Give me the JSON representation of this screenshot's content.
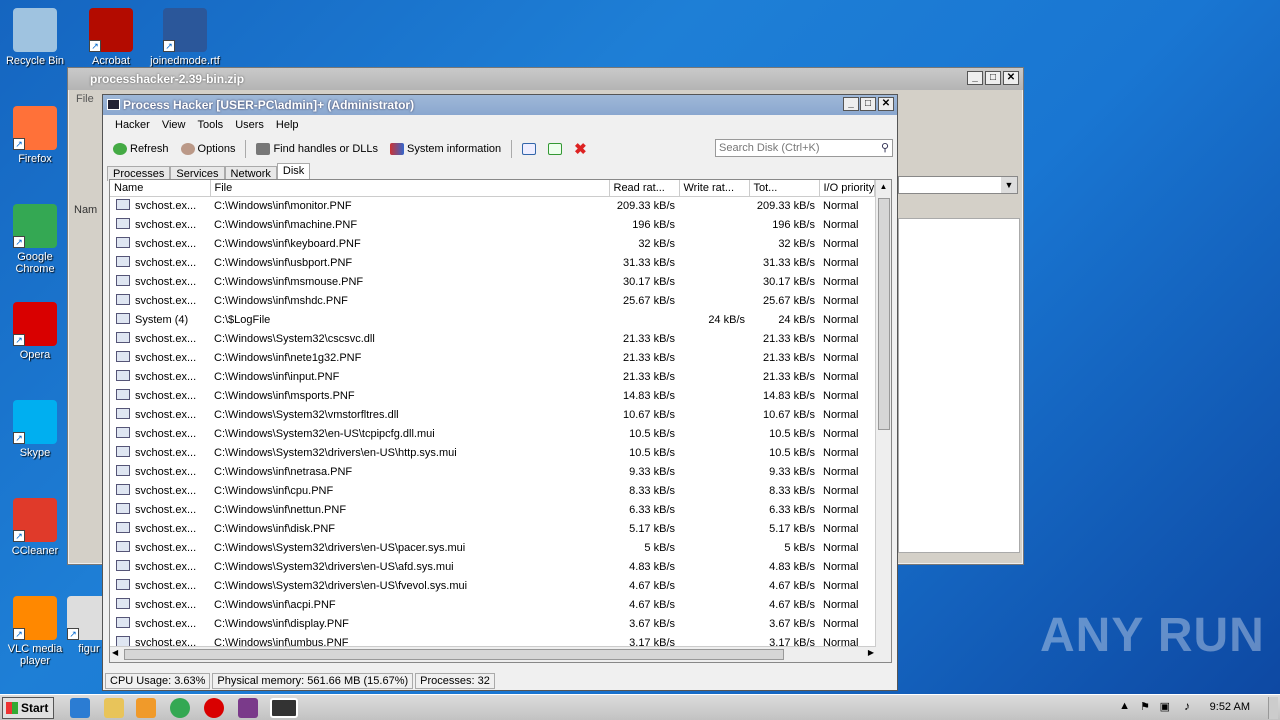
{
  "desktop": {
    "icons": [
      {
        "label": "Recycle Bin",
        "icon": "recycle-bin-icon",
        "color": "#9fc3e0"
      },
      {
        "label": "Acrobat",
        "icon": "acrobat-icon",
        "color": "#b30b00"
      },
      {
        "label": "joinedmode.rtf",
        "icon": "word-document-icon",
        "color": "#2b579a"
      },
      {
        "label": "Firefox",
        "icon": "firefox-icon",
        "color": "#ff7139"
      },
      {
        "label": "Google Chrome",
        "icon": "chrome-icon",
        "color": "#34a853"
      },
      {
        "label": "Opera",
        "icon": "opera-icon",
        "color": "#d90000"
      },
      {
        "label": "Skype",
        "icon": "skype-icon",
        "color": "#00aff0"
      },
      {
        "label": "CCleaner",
        "icon": "ccleaner-icon",
        "color": "#e03a2a"
      },
      {
        "label": "VLC media player",
        "icon": "vlc-icon",
        "color": "#ff8800"
      },
      {
        "label": "figur",
        "icon": "file-icon",
        "color": "#dddddd"
      }
    ]
  },
  "back_window": {
    "title": "processhacker-2.39-bin.zip",
    "menu_file": "File",
    "col_name": "Nam"
  },
  "window": {
    "title": "Process Hacker [USER-PC\\admin]+ (Administrator)",
    "menu": [
      "Hacker",
      "View",
      "Tools",
      "Users",
      "Help"
    ],
    "toolbar": {
      "refresh": "Refresh",
      "options": "Options",
      "find_handles": "Find handles or DLLs",
      "system_info": "System information"
    },
    "search_placeholder": "Search Disk (Ctrl+K)",
    "tabs": [
      "Processes",
      "Services",
      "Network",
      "Disk"
    ],
    "active_tab": "Disk",
    "columns": [
      "Name",
      "File",
      "Read rat...",
      "Write rat...",
      "Tot...",
      "I/O priority"
    ],
    "rows": [
      [
        "svchost.ex...",
        "C:\\Windows\\inf\\monitor.PNF",
        "209.33 kB/s",
        "",
        "209.33 kB/s",
        "Normal"
      ],
      [
        "svchost.ex...",
        "C:\\Windows\\inf\\machine.PNF",
        "196 kB/s",
        "",
        "196 kB/s",
        "Normal"
      ],
      [
        "svchost.ex...",
        "C:\\Windows\\inf\\keyboard.PNF",
        "32 kB/s",
        "",
        "32 kB/s",
        "Normal"
      ],
      [
        "svchost.ex...",
        "C:\\Windows\\inf\\usbport.PNF",
        "31.33 kB/s",
        "",
        "31.33 kB/s",
        "Normal"
      ],
      [
        "svchost.ex...",
        "C:\\Windows\\inf\\msmouse.PNF",
        "30.17 kB/s",
        "",
        "30.17 kB/s",
        "Normal"
      ],
      [
        "svchost.ex...",
        "C:\\Windows\\inf\\mshdc.PNF",
        "25.67 kB/s",
        "",
        "25.67 kB/s",
        "Normal"
      ],
      [
        "System (4)",
        "C:\\$LogFile",
        "",
        "24 kB/s",
        "24 kB/s",
        "Normal"
      ],
      [
        "svchost.ex...",
        "C:\\Windows\\System32\\cscsvc.dll",
        "21.33 kB/s",
        "",
        "21.33 kB/s",
        "Normal"
      ],
      [
        "svchost.ex...",
        "C:\\Windows\\inf\\nete1g32.PNF",
        "21.33 kB/s",
        "",
        "21.33 kB/s",
        "Normal"
      ],
      [
        "svchost.ex...",
        "C:\\Windows\\inf\\input.PNF",
        "21.33 kB/s",
        "",
        "21.33 kB/s",
        "Normal"
      ],
      [
        "svchost.ex...",
        "C:\\Windows\\inf\\msports.PNF",
        "14.83 kB/s",
        "",
        "14.83 kB/s",
        "Normal"
      ],
      [
        "svchost.ex...",
        "C:\\Windows\\System32\\vmstorfltres.dll",
        "10.67 kB/s",
        "",
        "10.67 kB/s",
        "Normal"
      ],
      [
        "svchost.ex...",
        "C:\\Windows\\System32\\en-US\\tcpipcfg.dll.mui",
        "10.5 kB/s",
        "",
        "10.5 kB/s",
        "Normal"
      ],
      [
        "svchost.ex...",
        "C:\\Windows\\System32\\drivers\\en-US\\http.sys.mui",
        "10.5 kB/s",
        "",
        "10.5 kB/s",
        "Normal"
      ],
      [
        "svchost.ex...",
        "C:\\Windows\\inf\\netrasa.PNF",
        "9.33 kB/s",
        "",
        "9.33 kB/s",
        "Normal"
      ],
      [
        "svchost.ex...",
        "C:\\Windows\\inf\\cpu.PNF",
        "8.33 kB/s",
        "",
        "8.33 kB/s",
        "Normal"
      ],
      [
        "svchost.ex...",
        "C:\\Windows\\inf\\nettun.PNF",
        "6.33 kB/s",
        "",
        "6.33 kB/s",
        "Normal"
      ],
      [
        "svchost.ex...",
        "C:\\Windows\\inf\\disk.PNF",
        "5.17 kB/s",
        "",
        "5.17 kB/s",
        "Normal"
      ],
      [
        "svchost.ex...",
        "C:\\Windows\\System32\\drivers\\en-US\\pacer.sys.mui",
        "5 kB/s",
        "",
        "5 kB/s",
        "Normal"
      ],
      [
        "svchost.ex...",
        "C:\\Windows\\System32\\drivers\\en-US\\afd.sys.mui",
        "4.83 kB/s",
        "",
        "4.83 kB/s",
        "Normal"
      ],
      [
        "svchost.ex...",
        "C:\\Windows\\System32\\drivers\\en-US\\fvevol.sys.mui",
        "4.67 kB/s",
        "",
        "4.67 kB/s",
        "Normal"
      ],
      [
        "svchost.ex...",
        "C:\\Windows\\inf\\acpi.PNF",
        "4.67 kB/s",
        "",
        "4.67 kB/s",
        "Normal"
      ],
      [
        "svchost.ex...",
        "C:\\Windows\\inf\\display.PNF",
        "3.67 kB/s",
        "",
        "3.67 kB/s",
        "Normal"
      ],
      [
        "svchost.ex...",
        "C:\\Windows\\inf\\umbus.PNF",
        "3.17 kB/s",
        "",
        "3.17 kB/s",
        "Normal"
      ]
    ],
    "status": {
      "cpu": "CPU Usage: 3.63%",
      "memory": "Physical memory: 561.66 MB (15.67%)",
      "processes": "Processes: 32"
    }
  },
  "taskbar": {
    "start": "Start",
    "clock": "9:52 AM"
  },
  "watermark": "ANY RUN"
}
